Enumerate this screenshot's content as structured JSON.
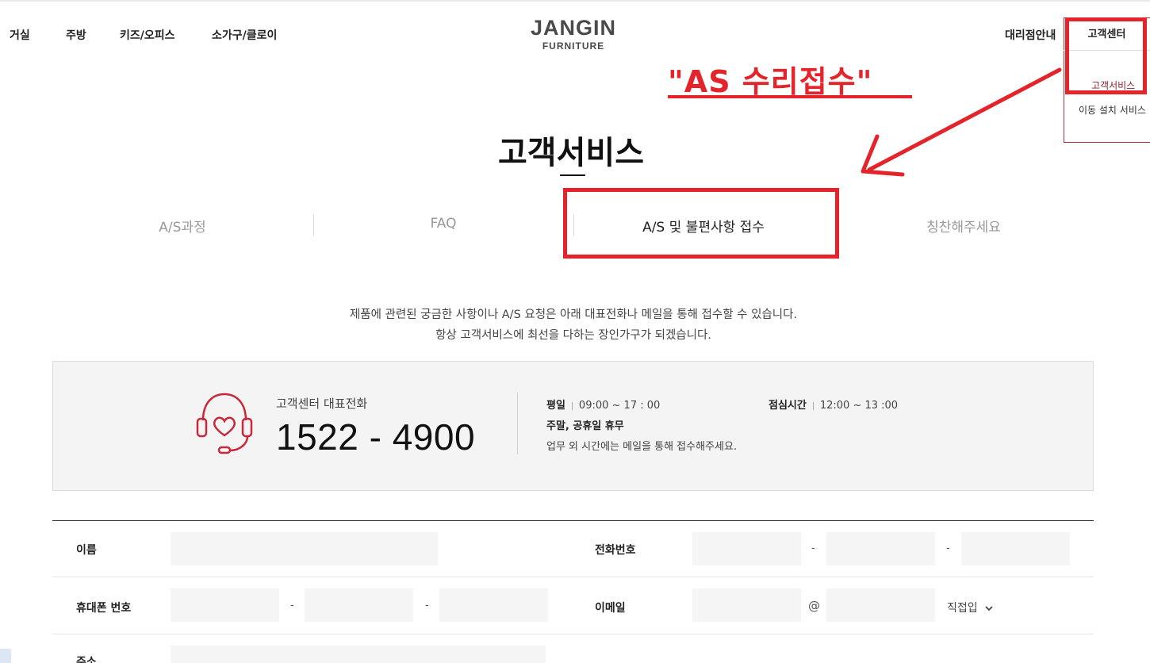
{
  "header": {
    "nav_left": [
      "거실",
      "주방",
      "키즈/오피스",
      "소가구/클로이"
    ],
    "logo_main": "JANGIN",
    "logo_sub": "FURNITURE",
    "nav_right": [
      "대리점안내",
      "고객센터"
    ]
  },
  "dropdown": {
    "items": [
      "고객서비스",
      "이동 설치 서비스"
    ]
  },
  "annotation": {
    "text": "\"AS 수리접수\"",
    "color": "#e4232a"
  },
  "page": {
    "title": "고객서비스",
    "tabs": [
      {
        "label": "A/S과정",
        "active": false
      },
      {
        "label": "FAQ",
        "active": false
      },
      {
        "label": "A/S 및 불편사항 접수",
        "active": true
      },
      {
        "label": "칭찬해주세요",
        "active": false
      }
    ],
    "intro_line1": "제품에 관련된 궁금한 사항이나 A/S 요청은 아래 대표전화나 메일을 통해 접수할 수 있습니다.",
    "intro_line2": "항상 고객서비스에 최선을 다하는 장인가구가 되겠습니다."
  },
  "contact": {
    "label": "고객센터 대표전화",
    "phone": "1522 - 4900",
    "weekday_label": "평일",
    "weekday_hours": "09:00 ~ 17 : 00",
    "lunch_label": "점심시간",
    "lunch_hours": "12:00 ~ 13 :00",
    "weekend_note": "주말, 공휴일 휴무",
    "after_hours_note": "업무 외 시간에는 메일을 통해 접수해주세요.",
    "icon": "headset-heart-icon",
    "icon_color": "#c8283a"
  },
  "form": {
    "name_label": "이름",
    "tel_label": "전화번호",
    "mobile_label": "휴대폰 번호",
    "email_label": "이메일",
    "address_label": "주소",
    "dash": "-",
    "at": "@",
    "email_domain_select": "직접입"
  }
}
